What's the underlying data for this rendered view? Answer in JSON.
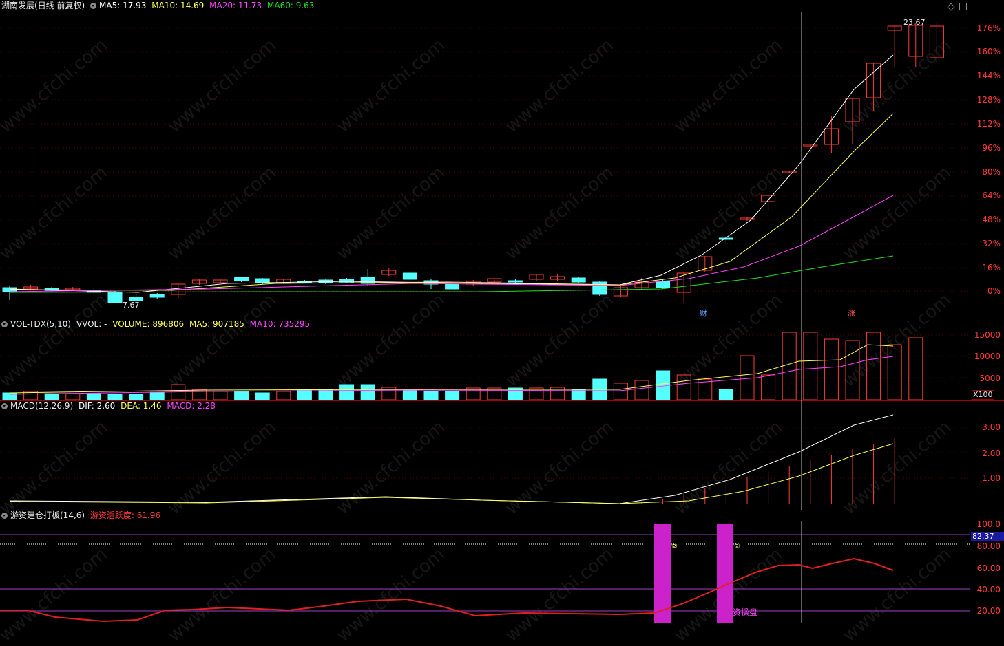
{
  "colors": {
    "up": "#ff3b3b",
    "down": "#54ffff",
    "ma5": "#ffffff",
    "ma10": "#ffff55",
    "ma20": "#ff44ff",
    "ma60": "#22dd22",
    "grid": "#7a0000",
    "axis_text": "#ff3a3a"
  },
  "price_panel": {
    "title": "湖南发展(日线 前复权)",
    "indicators": [
      {
        "label": "MA5: 17.93",
        "color": "#ffffff"
      },
      {
        "label": "MA10: 14.69",
        "color": "#ffff55"
      },
      {
        "label": "MA20: 11.73",
        "color": "#ff44ff"
      },
      {
        "label": "MA60: 9.63",
        "color": "#22dd22"
      }
    ],
    "axis_ticks": [
      "176%",
      "160%",
      "144%",
      "128%",
      "112%",
      "96%",
      "80%",
      "64%",
      "48%",
      "32%",
      "16%",
      "0%"
    ],
    "high_label": "23.67",
    "low_label": "7.67",
    "event_marks": [
      "财",
      "涨"
    ],
    "corner_icons": [
      "diamond-icon",
      "restore-icon"
    ]
  },
  "volume_panel": {
    "title": "VOL-TDX(5,10)",
    "indicators": [
      {
        "label": "VVOL: -",
        "color": "#e8e8e8"
      },
      {
        "label": "VOLUME: 896806",
        "color": "#ffff55"
      },
      {
        "label": "MA5: 907185",
        "color": "#ffff55"
      },
      {
        "label": "MA10: 735295",
        "color": "#ff44ff"
      }
    ],
    "axis_ticks": [
      "15000",
      "10000",
      "5000"
    ],
    "unit": "X100"
  },
  "macd_panel": {
    "title": "MACD(12,26,9)",
    "indicators": [
      {
        "label": "DIF: 2.60",
        "color": "#ffffff"
      },
      {
        "label": "DEA: 1.46",
        "color": "#ffff55"
      },
      {
        "label": "MACD: 2.28",
        "color": "#ff44ff"
      }
    ],
    "axis_ticks": [
      "3.00",
      "2.00",
      "1.00"
    ]
  },
  "custom_panel": {
    "title": "游资建仓打板(14,6)",
    "indicators": [
      {
        "label": "游资活跃度: 61.96",
        "color": "#ff3a3a"
      }
    ],
    "axis_ticks": [
      "100.0",
      "80.00",
      "60.00",
      "40.00",
      "20.00"
    ],
    "current_value": "82.37",
    "signal_text": "资操盘",
    "signal_marks": [
      "②",
      "②"
    ]
  },
  "watermark": "www.cfchi.com"
}
